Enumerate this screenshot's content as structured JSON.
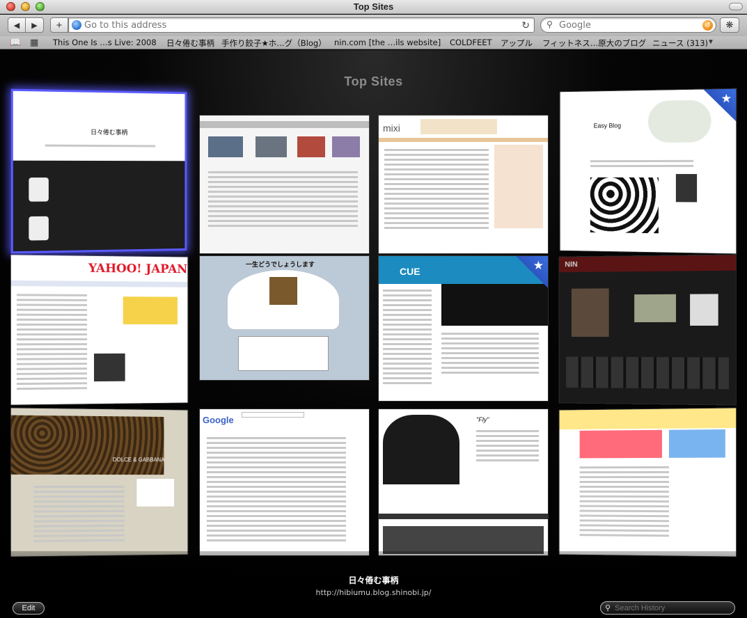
{
  "window": {
    "title": "Top Sites"
  },
  "toolbar": {
    "back_icon": "back-arrow",
    "forward_icon": "forward-arrow",
    "add_label": "+",
    "address_placeholder": "Go to this address",
    "search_placeholder": "Google"
  },
  "bookmarks": [
    "This One Is …s Live: 2008",
    "日々倦む事柄",
    "手作り餃子★ホ…グ（Blog）",
    "nin.com [the …ils website]",
    "COLDFEET",
    "アップル",
    "フィットネス…原大のブログ",
    "ニュース (313)"
  ],
  "top_sites": {
    "heading": "Top Sites",
    "selected_title": "日々倦む事柄",
    "selected_url": "http://hibiumu.blog.shinobi.jp/",
    "edit_label": "Edit",
    "history_placeholder": "Search History",
    "tiles": [
      {
        "name": "hibiumu-blog",
        "label": "日々倦む事柄"
      },
      {
        "name": "apple",
        "label": ""
      },
      {
        "name": "mixi",
        "label": "mixi"
      },
      {
        "name": "easy-blog",
        "label": "Easy Blog"
      },
      {
        "name": "yahoo-japan",
        "label": "YAHOO! JAPAN"
      },
      {
        "name": "snow-game",
        "label": "一生どうでしょうします"
      },
      {
        "name": "cue",
        "label": "CUE"
      },
      {
        "name": "nin",
        "label": "NIN"
      },
      {
        "name": "fitness-blog",
        "label": "DOLCE & GABBANA"
      },
      {
        "name": "google",
        "label": "Google"
      },
      {
        "name": "coldfeet",
        "label": "\"Fly\""
      },
      {
        "name": "ticket-site",
        "label": ""
      }
    ]
  }
}
